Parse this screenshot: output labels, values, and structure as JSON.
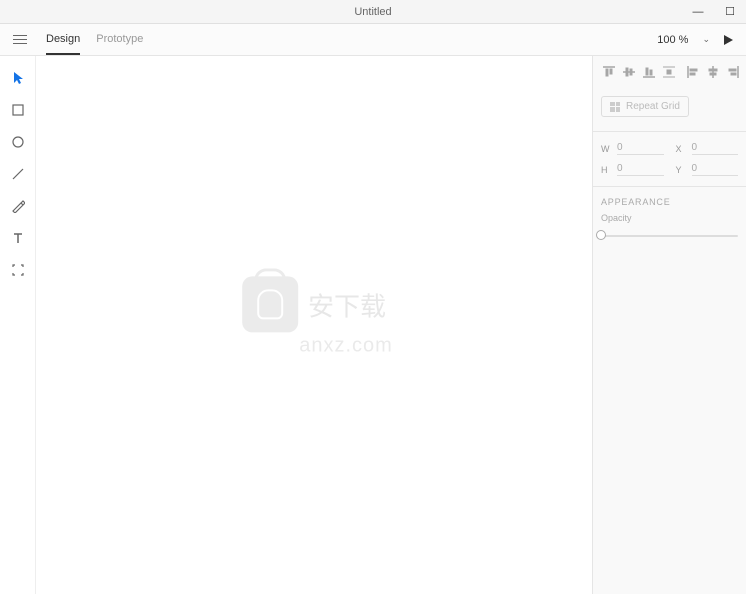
{
  "titlebar": {
    "title": "Untitled"
  },
  "topbar": {
    "tabs": [
      {
        "label": "Design",
        "active": true
      },
      {
        "label": "Prototype",
        "active": false
      }
    ],
    "zoom": "100 %"
  },
  "tools": [
    {
      "name": "select",
      "active": true
    },
    {
      "name": "rectangle",
      "active": false
    },
    {
      "name": "ellipse",
      "active": false
    },
    {
      "name": "line",
      "active": false
    },
    {
      "name": "pen",
      "active": false
    },
    {
      "name": "text",
      "active": false
    },
    {
      "name": "artboard",
      "active": false
    }
  ],
  "panel": {
    "repeat_grid_label": "Repeat Grid",
    "dims": {
      "w_label": "w",
      "w_val": "0",
      "h_label": "H",
      "h_val": "0",
      "x_label": "X",
      "x_val": "0",
      "y_label": "Y",
      "y_val": "0"
    },
    "appearance_label": "APPEARANCE",
    "opacity_label": "Opacity"
  },
  "watermark": {
    "text": "安下载",
    "url": "anxz.com"
  }
}
